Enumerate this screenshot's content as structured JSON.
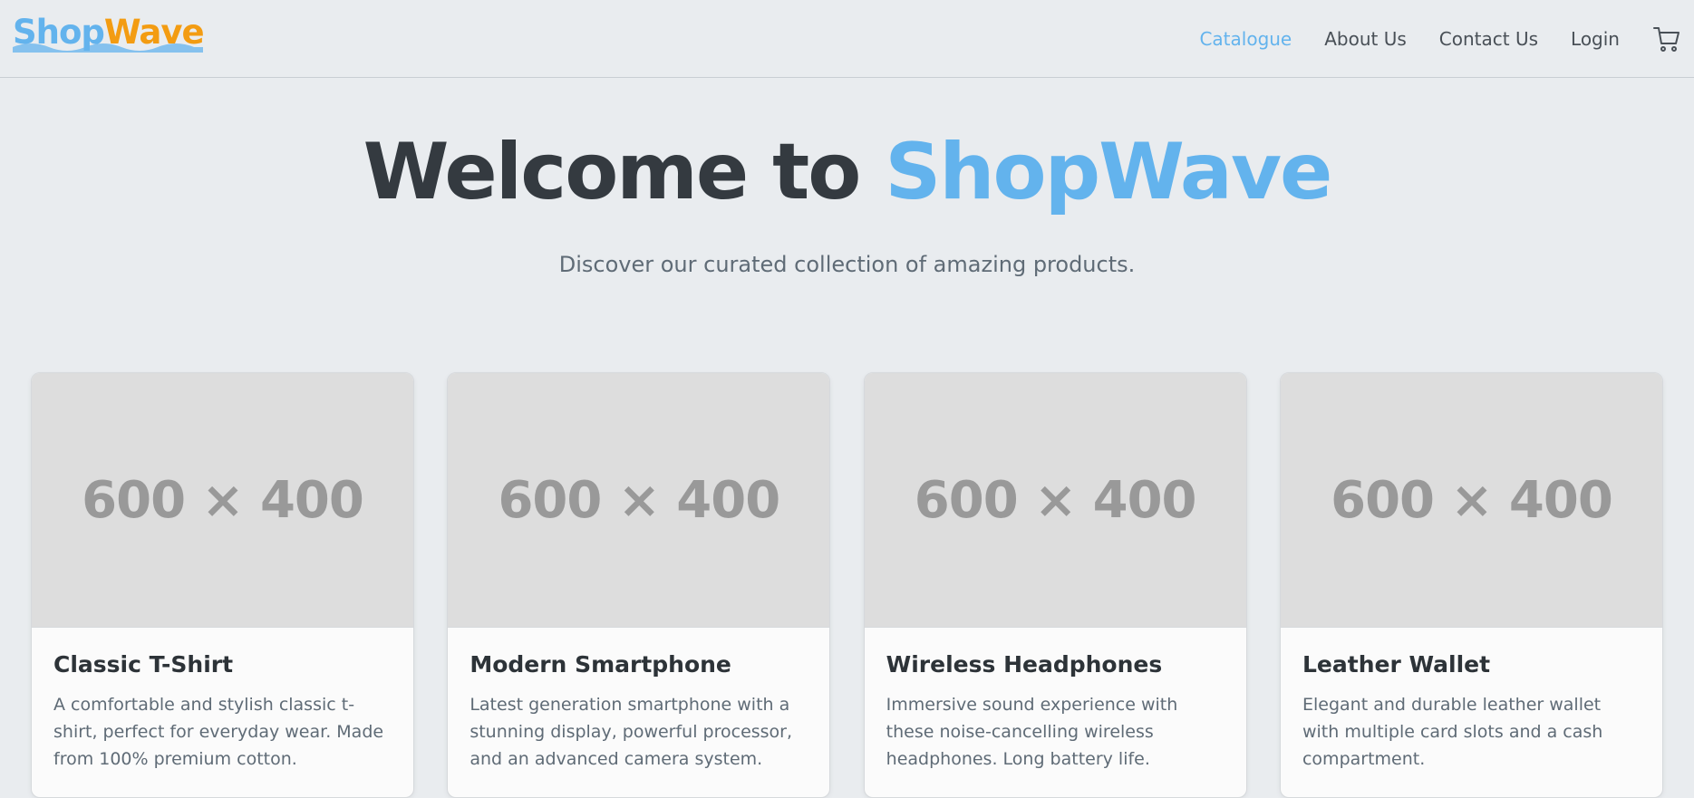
{
  "brand": {
    "part1": "Shop",
    "part2": "Wave",
    "color_primary": "#63b3ed",
    "color_secondary": "#f39c12"
  },
  "nav": {
    "items": [
      {
        "label": "Catalogue",
        "active": true
      },
      {
        "label": "About Us",
        "active": false
      },
      {
        "label": "Contact Us",
        "active": false
      },
      {
        "label": "Login",
        "active": false
      }
    ],
    "cart_icon": "shopping-cart-icon"
  },
  "hero": {
    "title_prefix": "Welcome to ",
    "title_accent": "ShopWave",
    "subtitle": "Discover our curated collection of amazing products."
  },
  "products": [
    {
      "image_placeholder": "600 × 400",
      "title": "Classic T-Shirt",
      "description": "A comfortable and stylish classic t-shirt, perfect for everyday wear. Made from 100% premium cotton."
    },
    {
      "image_placeholder": "600 × 400",
      "title": "Modern Smartphone",
      "description": "Latest generation smartphone with a stunning display, powerful processor, and an advanced camera system."
    },
    {
      "image_placeholder": "600 × 400",
      "title": "Wireless Headphones",
      "description": "Immersive sound experience with these noise-cancelling wireless headphones. Long battery life."
    },
    {
      "image_placeholder": "600 × 400",
      "title": "Leather Wallet",
      "description": "Elegant and durable leather wallet with multiple card slots and a cash compartment."
    }
  ]
}
